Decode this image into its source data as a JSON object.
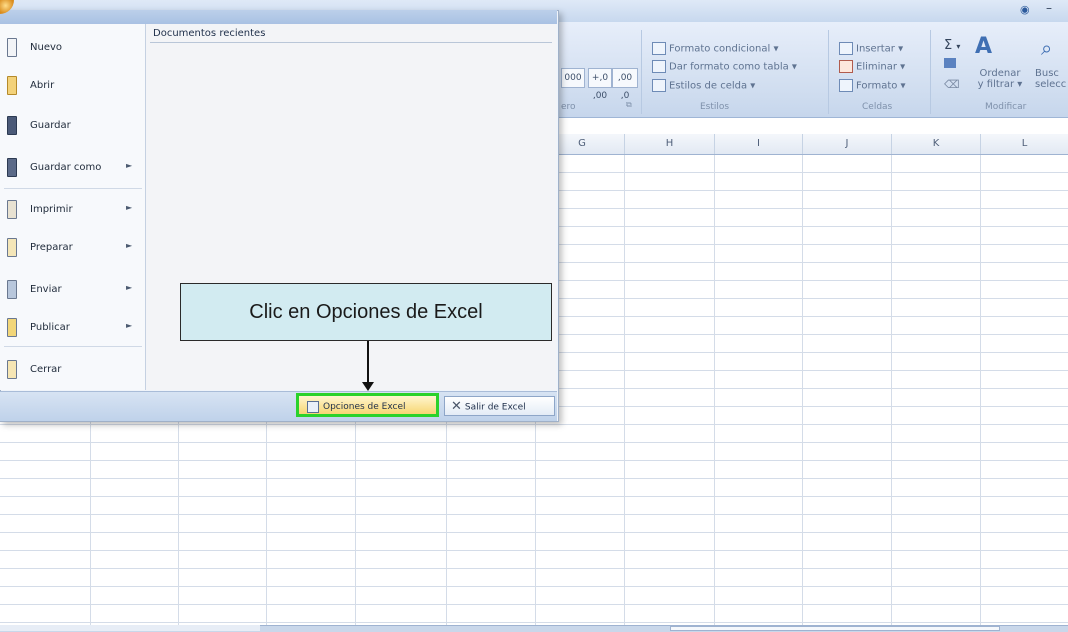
{
  "ribbon": {
    "styles_group": {
      "conditional_format": "Formato condicional",
      "format_as_table": "Dar formato como tabla",
      "cell_styles": "Estilos de celda",
      "label": "Estilos"
    },
    "cells_group": {
      "insert": "Insertar",
      "delete": "Eliminar",
      "format": "Formato",
      "label": "Celdas"
    },
    "modify_group": {
      "sort_line1": "Ordenar",
      "sort_line2": "y filtrar",
      "find_line1": "Busc",
      "find_line2": "selecc",
      "label": "Modificar"
    },
    "number_group": {
      "fmt_thousands": "000",
      "inc_decimal": "+,0 ,00",
      "dec_decimal": ",00 ,0",
      "label": "ero"
    },
    "autosum_symbol": "Σ"
  },
  "columns": [
    "G",
    "H",
    "I",
    "J",
    "K",
    "L"
  ],
  "office_menu": {
    "items": [
      {
        "label": "Nuevo",
        "has_submenu": false
      },
      {
        "label": "Abrir",
        "has_submenu": false
      },
      {
        "label": "Guardar",
        "has_submenu": false
      },
      {
        "label": "Guardar como",
        "has_submenu": true
      },
      {
        "label": "Imprimir",
        "has_submenu": true
      },
      {
        "label": "Preparar",
        "has_submenu": true
      },
      {
        "label": "Enviar",
        "has_submenu": true
      },
      {
        "label": "Publicar",
        "has_submenu": true
      },
      {
        "label": "Cerrar",
        "has_submenu": false
      }
    ],
    "recent_docs_title": "Documentos recientes",
    "options_button": "Opciones de Excel",
    "exit_button": "Salir de Excel"
  },
  "callout": {
    "text": "Clic en Opciones de Excel"
  },
  "colors": {
    "highlight": "#2bd22b",
    "callout_bg": "#d2ebf1"
  }
}
